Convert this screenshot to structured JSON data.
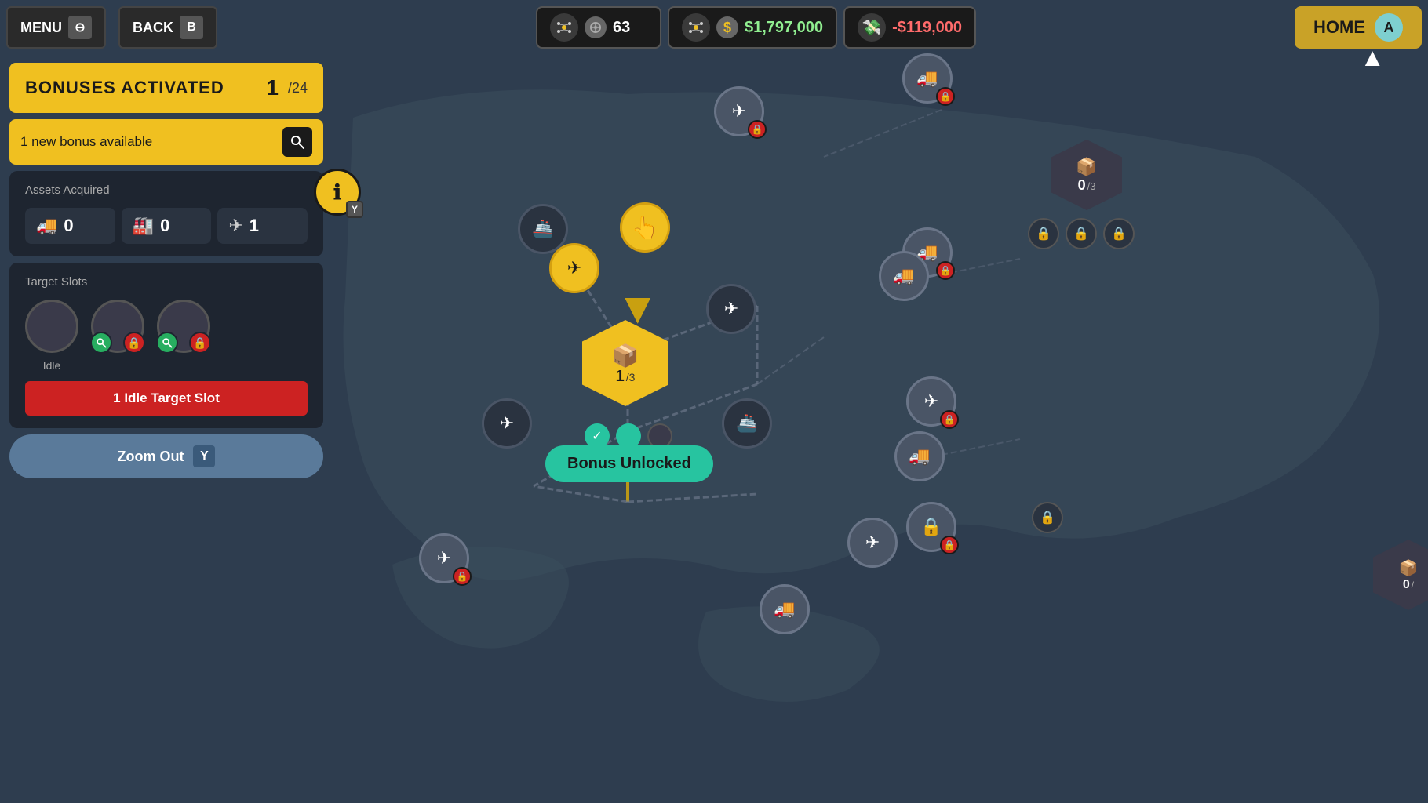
{
  "topbar": {
    "menu_label": "MENU",
    "menu_key": "⊖",
    "back_label": "BACK",
    "back_key": "B",
    "connections_count": "63",
    "money_balance": "$1,797,000",
    "money_delta": "-$119,000",
    "home_label": "HOME",
    "avatar_label": "A"
  },
  "sidebar": {
    "bonuses_title": "BONUSES ACTIVATED",
    "bonuses_count": "1",
    "bonuses_total": "/24",
    "search_placeholder": "1 new bonus available",
    "assets_title": "Assets Acquired",
    "assets": [
      {
        "icon": "🚚",
        "count": "0"
      },
      {
        "icon": "🏭",
        "count": "0"
      },
      {
        "icon": "✈",
        "count": "1"
      }
    ],
    "target_title": "Target Slots",
    "slots": [
      {
        "type": "idle",
        "label": "Idle"
      },
      {
        "type": "locked-search"
      },
      {
        "type": "locked-search"
      }
    ],
    "idle_banner": "1 Idle Target Slot",
    "zoom_label": "Zoom Out",
    "zoom_key": "Y"
  },
  "map": {
    "bonus_unlocked_label": "Bonus Unlocked",
    "center_hex": {
      "icon": "📦",
      "count": "1",
      "total": "/3"
    }
  },
  "info_btn": {
    "label": "ℹ",
    "key": "Y"
  },
  "cursor": "▲"
}
